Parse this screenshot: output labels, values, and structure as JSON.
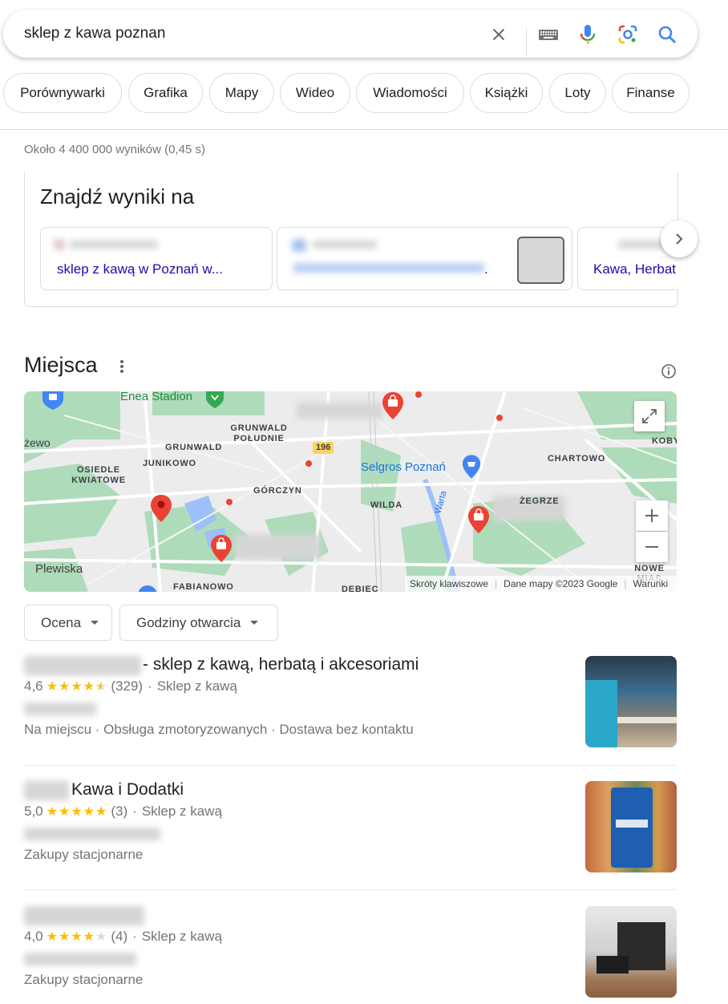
{
  "search": {
    "query": "sklep z kawa poznan"
  },
  "chips": [
    "Porównywarki",
    "Grafika",
    "Mapy",
    "Wideo",
    "Wiadomości",
    "Książki",
    "Loty",
    "Finanse"
  ],
  "stats": "Około 4 400 000 wyników (0,45 s)",
  "find_results": {
    "title": "Znajdź wyniki na",
    "cards": [
      {
        "link": "sklep z kawą w Poznań w..."
      },
      {
        "link": "."
      },
      {
        "link": "Kawa, Herbat"
      }
    ]
  },
  "places": {
    "title": "Miejsca",
    "map": {
      "labels": [
        "Enea Stadion",
        "GRUNWALD POŁUDNIE",
        "GRUNWALD",
        "żewo",
        "OSIEDLE KWIATOWE",
        "JUNIKOWO",
        "GÓRCZYN",
        "196",
        "Selgros Poznań",
        "CHARTOWO",
        "KOBY",
        "WILDA",
        "Warta",
        "ŻEGRZE",
        "Plewiska",
        "FABIANOWO",
        "DEBIEC",
        "NOWE MIAS"
      ],
      "attribution": {
        "shortcuts": "Skróty klawiszowe",
        "data": "Dane mapy ©2023 Google",
        "terms": "Warunki"
      }
    },
    "filters": [
      "Ocena",
      "Godziny otwarcia"
    ],
    "results": [
      {
        "title": "- sklep z kawą, herbatą i akcesoriami",
        "rating": "4,6",
        "stars": 4.5,
        "reviews": "(329)",
        "category": "Sklep z kawą",
        "services": "Na miejscu · Obsługa zmotoryzowanych · Dostawa bez kontaktu"
      },
      {
        "title": "Kawa i Dodatki",
        "rating": "5,0",
        "stars": 5,
        "reviews": "(3)",
        "category": "Sklep z kawą",
        "services": "Zakupy stacjonarne"
      },
      {
        "title": "",
        "rating": "4,0",
        "stars": 4,
        "reviews": "(4)",
        "category": "Sklep z kawą",
        "services": "Zakupy stacjonarne"
      }
    ]
  },
  "icons": [
    "clear-icon",
    "keyboard-icon",
    "mic-icon",
    "lens-icon",
    "search-icon",
    "chevron-right-icon",
    "more-vert-icon",
    "info-icon",
    "expand-icon",
    "zoom-in-icon",
    "zoom-out-icon",
    "map-pin-icon",
    "shopping-pin-icon"
  ],
  "colors": {
    "link": "#1a0dab",
    "star": "#fbbc04",
    "pin": "#ea4335",
    "map_green": "#a8dab5"
  }
}
